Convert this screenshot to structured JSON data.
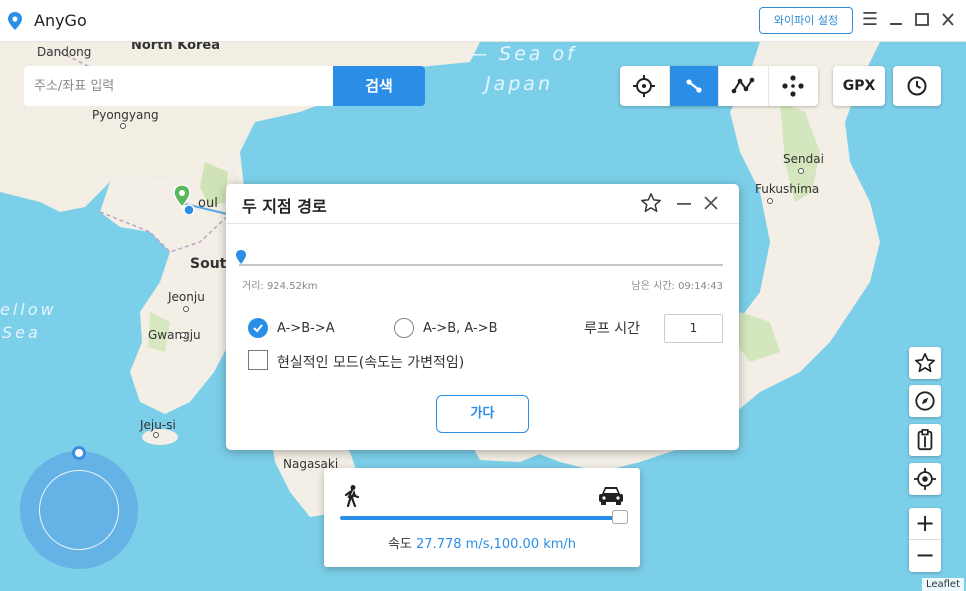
{
  "app": {
    "title": "AnyGo",
    "wifi_button": "와이파이 설정"
  },
  "window_controls": [
    "menu",
    "minimize",
    "maximize",
    "close"
  ],
  "search": {
    "placeholder": "주소/좌표 입력",
    "button": "검색"
  },
  "toolbar": {
    "modes": [
      {
        "icon": "crosshair-icon",
        "active": false
      },
      {
        "icon": "two-point-route-icon",
        "active": true
      },
      {
        "icon": "multi-point-route-icon",
        "active": false
      },
      {
        "icon": "joystick-icon",
        "active": false
      }
    ],
    "gpx_label": "GPX",
    "history_icon": "clock-icon"
  },
  "map": {
    "seas": [
      "— Sea of",
      "Japan",
      "ellow",
      "Sea"
    ],
    "places": {
      "dandong": "Dandong",
      "north_korea": "North Korea",
      "pyongyang": "Pyongyang",
      "seoul": "oul",
      "south": "South",
      "jeonju": "Jeonju",
      "gwangju": "Gwangju",
      "jeju": "Jeju-si",
      "nagasaki": "Nagasaki",
      "sendai": "Sendai",
      "fukushima": "Fukushima"
    },
    "attribution": "Leaflet"
  },
  "dialog": {
    "title": "두 지점 경로",
    "distance": "거리: 924.52km",
    "remaining": "남은 시간: 09:14:43",
    "option_ab_a": "A->B->A",
    "option_ab_ab": "A->B, A->B",
    "loop_label": "루프 시간",
    "loop_value": "1",
    "realistic_mode": "현실적인 모드(속도는 가변적임)",
    "go_button": "가다"
  },
  "speed": {
    "label": "속도",
    "value": "27.778 m/s,100.00 km/h",
    "level_fraction": 1.0
  },
  "colors": {
    "accent": "#2b8ee6",
    "sea": "#7ccfe9",
    "land": "#f3efe6"
  }
}
